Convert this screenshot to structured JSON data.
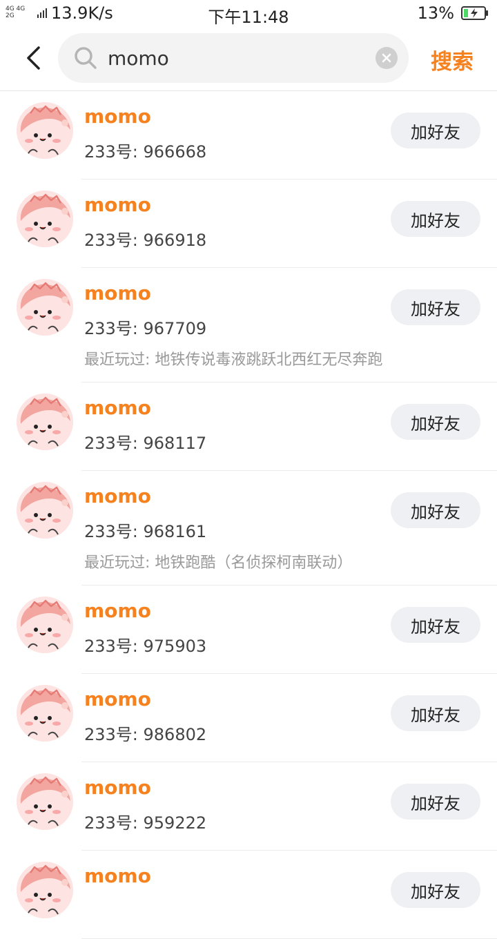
{
  "status_bar": {
    "network_top": "4G 4G",
    "network_bottom": "2G",
    "speed": "13.9K/s",
    "time": "下午11:48",
    "battery_percent": "13%"
  },
  "header": {
    "back_icon": "chevron-left-icon",
    "search_value": "momo",
    "search_action": "搜索",
    "accent_color": "#f5821f"
  },
  "results": [
    {
      "name": "momo",
      "uid": "233号: 966668",
      "recent": "",
      "button": "加好友"
    },
    {
      "name": "momo",
      "uid": "233号: 966918",
      "recent": "",
      "button": "加好友"
    },
    {
      "name": "momo",
      "uid": "233号: 967709",
      "recent": "最近玩过: 地铁传说毒液跳跃北西红无尽奔跑",
      "button": "加好友"
    },
    {
      "name": "momo",
      "uid": "233号: 968117",
      "recent": "",
      "button": "加好友"
    },
    {
      "name": "momo",
      "uid": "233号: 968161",
      "recent": "最近玩过: 地铁跑酷（名侦探柯南联动）",
      "button": "加好友"
    },
    {
      "name": "momo",
      "uid": "233号: 975903",
      "recent": "",
      "button": "加好友"
    },
    {
      "name": "momo",
      "uid": "233号: 986802",
      "recent": "",
      "button": "加好友"
    },
    {
      "name": "momo",
      "uid": "233号: 959222",
      "recent": "",
      "button": "加好友"
    },
    {
      "name": "momo",
      "uid": "",
      "recent": "",
      "button": "加好友"
    }
  ]
}
